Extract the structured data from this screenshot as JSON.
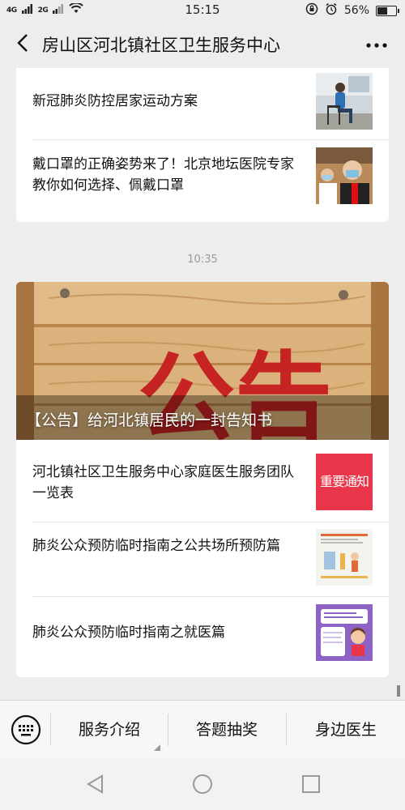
{
  "status_bar": {
    "signal_1": "4G",
    "signal_2": "2G",
    "time": "15:15",
    "battery_percent": "56%",
    "battery_level": 0.56
  },
  "header": {
    "title": "房山区河北镇社区卫生服务中心"
  },
  "top_card": {
    "items": [
      {
        "title": "新冠肺炎防控居家运动方案",
        "thumb": "exercise-photo"
      },
      {
        "title": "戴口罩的正确姿势来了！北京地坛医院专家教你如何选择、佩戴口罩",
        "thumb": "doctor-mask-photo"
      }
    ]
  },
  "timestamp": "10:35",
  "main_card": {
    "cover_headline": "【公告】给河北镇居民的一封告知书",
    "cover_banner_text": "公告",
    "items": [
      {
        "title": "河北镇社区卫生服务中心家庭医生服务团队一览表",
        "thumb_text": "重要通知",
        "thumb_color": "#e8374b"
      },
      {
        "title": "肺炎公众预防临时指南之公共场所预防篇",
        "thumb": "public-places-guide"
      },
      {
        "title": "肺炎公众预防临时指南之就医篇",
        "thumb": "medical-visit-guide",
        "thumb_color": "#8e63c6"
      }
    ]
  },
  "bottom_menu": {
    "items": [
      "服务介绍",
      "答题抽奖",
      "身边医生"
    ]
  },
  "colors": {
    "background": "#ededed",
    "card": "#ffffff",
    "notice_red": "#e8374b",
    "wood": "#d9b07a",
    "guide_purple": "#8e63c6"
  }
}
